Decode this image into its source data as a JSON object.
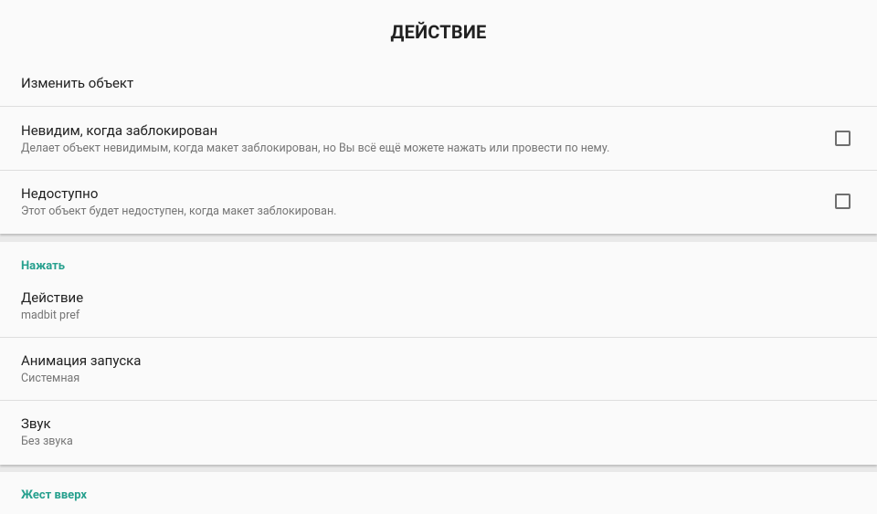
{
  "header": {
    "title": "ДЕЙСТВИЕ"
  },
  "section_object": {
    "edit_item": {
      "title": "Изменить объект"
    },
    "invisible_when_locked": {
      "title": "Невидим, когда заблокирован",
      "subtitle": "Делает объект невидимым, когда макет заблокирован, но Вы всё ещё можете нажать или провести по нему.",
      "checked": false
    },
    "unavailable": {
      "title": "Недоступно",
      "subtitle": "Этот объект будет недоступен, когда макет заблокирован.",
      "checked": false
    }
  },
  "section_tap": {
    "category": "Нажать",
    "action": {
      "title": "Действие",
      "subtitle": "madbit pref"
    },
    "launch_animation": {
      "title": "Анимация запуска",
      "subtitle": "Системная"
    },
    "sound": {
      "title": "Звук",
      "subtitle": "Без звука"
    }
  },
  "section_swipe_up": {
    "category": "Жест вверх"
  },
  "colors": {
    "accent": "#26a08e",
    "background": "#fafafa",
    "separator": "#e9e9e9",
    "primary_text": "#212121",
    "secondary_text": "#757575"
  }
}
